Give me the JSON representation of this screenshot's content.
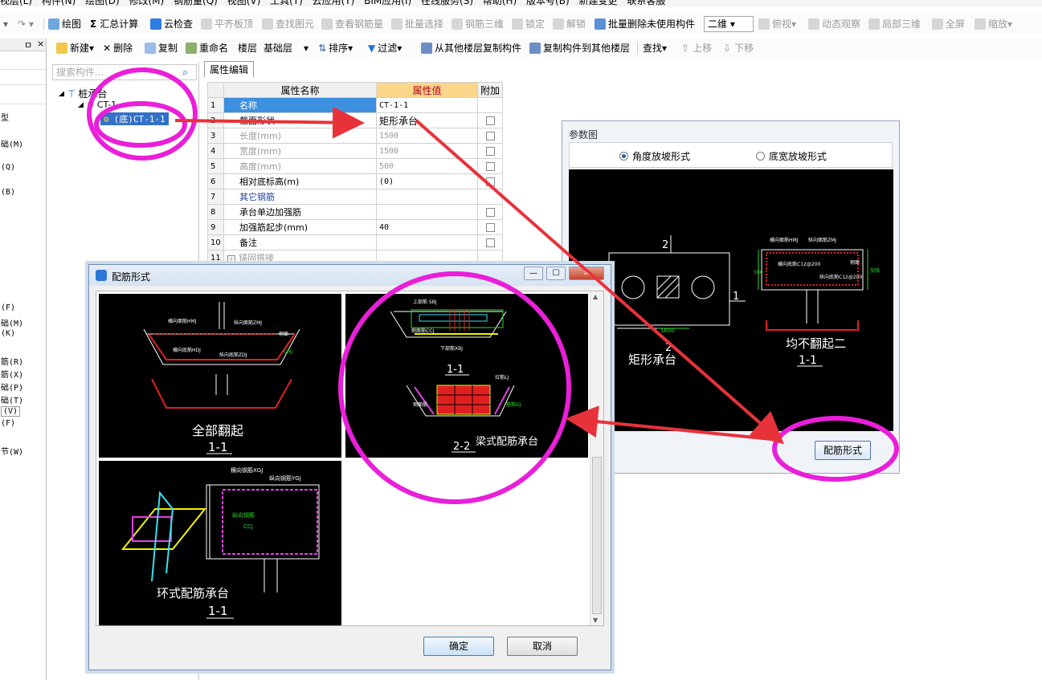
{
  "menubar": {
    "items": [
      "视层(L)",
      "构件(N)",
      "绘图(D)",
      "修改(M)",
      "钢筋量(Q)",
      "视图(V)",
      "工具(T)",
      "云应用(Y)",
      "BIM应用(I)",
      "在线服务(S)",
      "帮助(H)",
      "版本号(B)",
      "新建变更",
      "联系客服"
    ]
  },
  "toolbar1": {
    "draw": "绘图",
    "calc": "汇总计算",
    "cloud_check": "云检查",
    "flat_top": "平齐板顶",
    "find_element": "查找图元",
    "view_rebar": "查看钢筋量",
    "batch_select": "批量选择",
    "rebar_3d": "钢筋三维",
    "lock": "锁定",
    "unlock": "解锁",
    "batch_delete": "批量删除未使用构件",
    "view_mode": "二维",
    "top_view": "俯视",
    "dynamic": "动态观察",
    "local_3d": "局部三维",
    "fullscreen": "全屏",
    "zoom": "缩放"
  },
  "toolbar2": {
    "new": "新建",
    "delete": "删除",
    "copy": "复制",
    "rename": "重命名",
    "floor_label": "楼层",
    "floor_value": "基础层",
    "sort": "排序",
    "filter": "过滤",
    "copy_from": "从其他楼层复制构件",
    "copy_to": "复制构件到其他楼层",
    "find": "查找",
    "move_up": "上移",
    "move_down": "下移"
  },
  "left_panel": {
    "pin": "ㅁ",
    "close": "×",
    "items": [
      "型",
      "础(M)",
      "(Q)",
      "(B)",
      "(F)",
      "础(M)",
      "(K)",
      "筋(R)",
      "筋(X)",
      "础(P)",
      "础(T)",
      "(V)",
      "(F)",
      "节(W)"
    ]
  },
  "tree": {
    "search_placeholder": "搜索构件...",
    "root": "桩承台",
    "child": "CT-1",
    "leaf": "(底)CT-1-1"
  },
  "props": {
    "tab": "属性编辑",
    "headers": [
      "属性名称",
      "属性值",
      "附加"
    ],
    "rows": [
      {
        "n": "1",
        "name": "名称",
        "value": "CT-1-1"
      },
      {
        "n": "2",
        "name": "截面形状",
        "value": "矩形承台"
      },
      {
        "n": "3",
        "name": "长度(mm)",
        "value": "1500"
      },
      {
        "n": "4",
        "name": "宽度(mm)",
        "value": "1500"
      },
      {
        "n": "5",
        "name": "高度(mm)",
        "value": "500"
      },
      {
        "n": "6",
        "name": "相对底标高(m)",
        "value": "(0)"
      },
      {
        "n": "7",
        "name": "其它钢筋",
        "value": ""
      },
      {
        "n": "8",
        "name": "承台单边加强筋",
        "value": ""
      },
      {
        "n": "9",
        "name": "加强筋起步(mm)",
        "value": "40"
      },
      {
        "n": "10",
        "name": "备注",
        "value": ""
      },
      {
        "n": "11",
        "name": "锚固搭接",
        "value": ""
      }
    ]
  },
  "param_window": {
    "title": "参数图",
    "radio_angle": "角度放坡形式",
    "radio_bottom": "底宽放坡形式",
    "button": "配筋形式",
    "drawing": {
      "mark_2_top": "2",
      "mark_1": "1",
      "mark_2_bottom": "2",
      "dim": "1600",
      "shape_label": "矩形承台",
      "tag_1": "横向面筋HMJ",
      "tag_2": "纵向面筋ZMJ",
      "tag_3": "横向底筋C12@200",
      "tag_4": "纵向底筋C12@200",
      "tag_5": "侧面",
      "tag_6": "加强",
      "dim_h": "500",
      "caption": "均不翻起二",
      "section": "1-1"
    }
  },
  "dialog": {
    "title": "配筋形式",
    "ok": "确定",
    "cancel": "取消",
    "cell1": {
      "caption": "全部翻起",
      "section": "1-1",
      "tag_a": "横向面筋HMJ",
      "tag_b": "纵向面筋ZMJ",
      "tag_c": "横向底筋HDJ",
      "tag_d": "纵向底筋ZDJ",
      "tag_e": "侧面",
      "tag_f": "CMJ"
    },
    "cell2": {
      "caption": "梁式配筋承台",
      "section_top": "1-1",
      "section_bottom": "2-2",
      "tag_a": "上部筋 SBJ",
      "tag_b": "侧面筋CCJ",
      "tag_c": "下部筋XBJ",
      "tag_d": "拉筋LJ",
      "tag_e": "侧面筋",
      "tag_f": "箍筋GJ"
    },
    "cell3": {
      "caption": "环式配筋承台",
      "section": "1-1",
      "tag_a": "横向钢筋XGJ",
      "tag_b": "纵向钢筋YGJ",
      "tag_c": "纵向钢筋",
      "tag_d": "CCJ"
    }
  },
  "colors": {
    "annotation": "#e91fd9",
    "arrow": "#e8323a",
    "cad_white": "#ffffff",
    "cad_red": "#e02020",
    "cad_green": "#2ed62e",
    "cad_yellow": "#f2f200",
    "cad_magenta": "#e040e0",
    "cad_cyan": "#39e0f0"
  }
}
